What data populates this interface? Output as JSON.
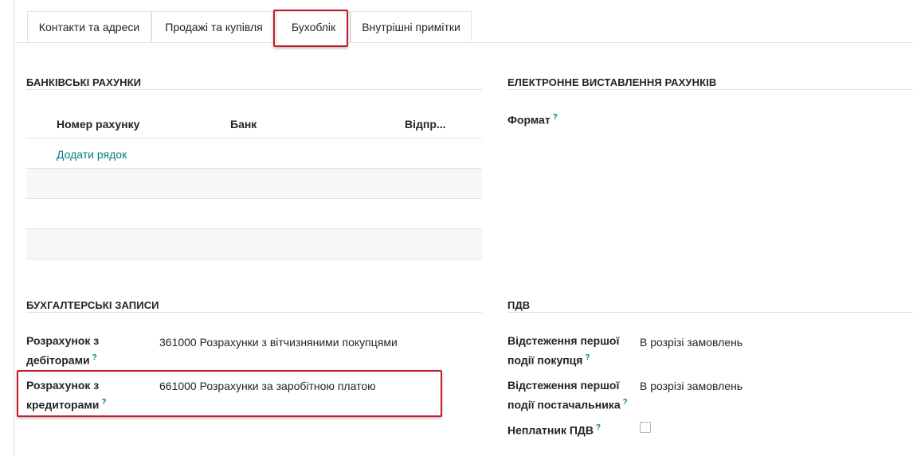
{
  "tabs": [
    {
      "label": "Контакти та адреси"
    },
    {
      "label": "Продажі та купівля"
    },
    {
      "label": "Бухоблік"
    },
    {
      "label": "Внутрішні примітки"
    }
  ],
  "bank": {
    "title": "БАНКІВСЬКІ РАХУНКИ",
    "columns": [
      "Номер рахунку",
      "Банк",
      "Відпр..."
    ],
    "add_line": "Додати рядок"
  },
  "einvoice": {
    "title": "ЕЛЕКТРОННЕ ВИСТАВЛЕННЯ РАХУНКІВ",
    "format_label": "Формат"
  },
  "accounting": {
    "title": "БУХГАЛТЕРСЬКІ ЗАПИСИ",
    "receivable_label_1": "Розрахунок з",
    "receivable_label_2": "дебіторами",
    "receivable_value": "361000 Розрахунки з вітчизняними покупцями",
    "payable_label_1": "Розрахунок з",
    "payable_label_2": "кредиторами",
    "payable_value": "661000 Розрахунки за заробітною платою"
  },
  "vat": {
    "title": "ПДВ",
    "customer_label_1": "Відстеження першої",
    "customer_label_2": "події покупця",
    "customer_value": "В розрізі замовлень",
    "vendor_label_1": "Відстеження першої",
    "vendor_label_2": "події постачальника",
    "vendor_value": "В розрізі замовлень",
    "nonpayer_label": "Неплатник ПДВ",
    "nonpayer_checked": false
  },
  "help_mark": "?",
  "colors": {
    "accent": "#017e84",
    "highlight": "#c01c28",
    "border": "#dee2e6"
  }
}
